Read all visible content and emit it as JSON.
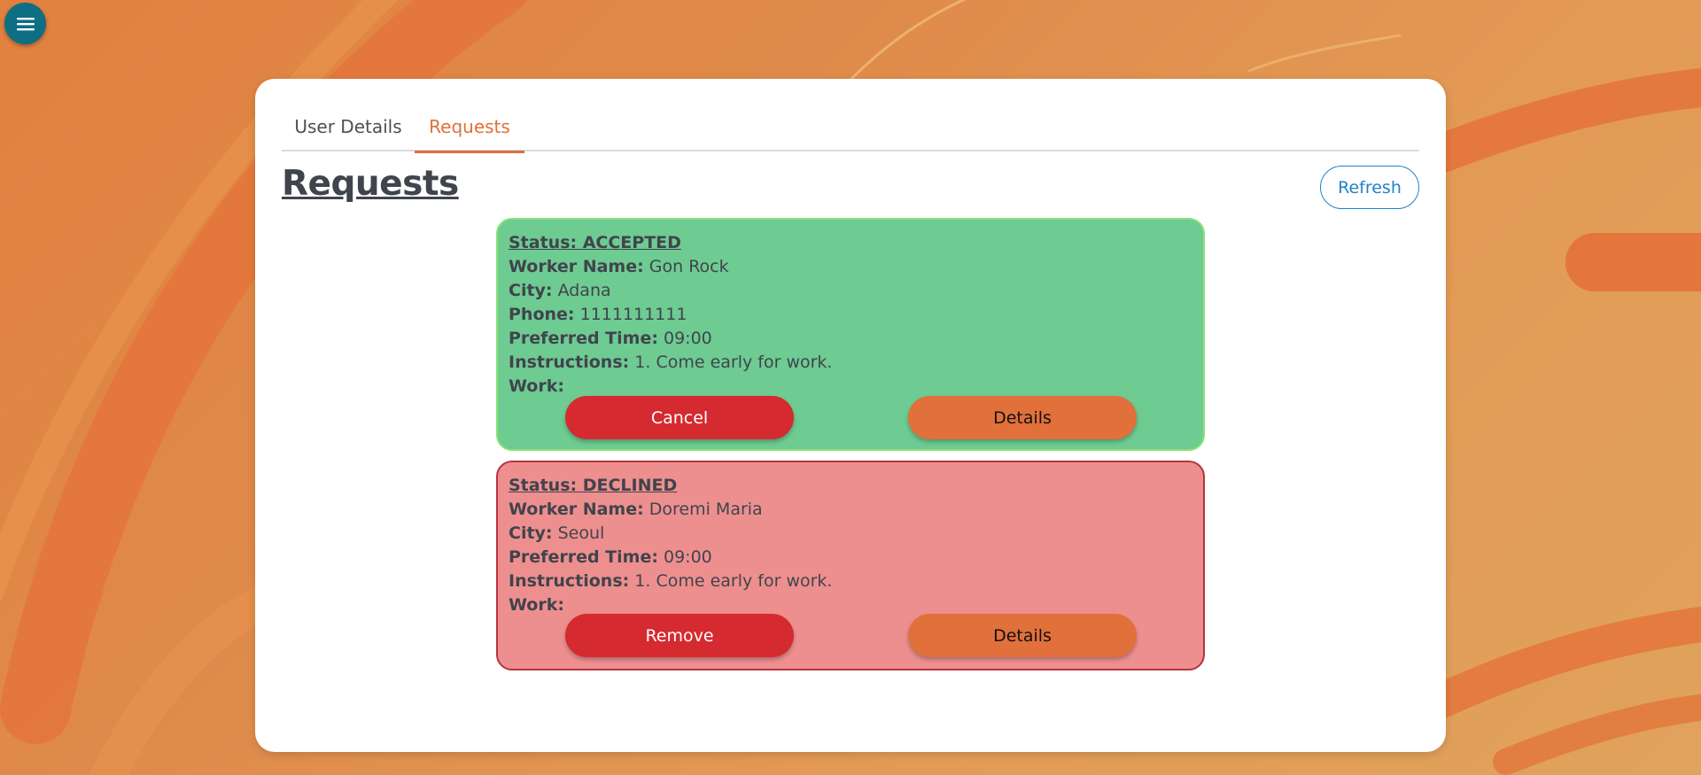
{
  "tabs": [
    {
      "label": "User Details"
    },
    {
      "label": "Requests"
    }
  ],
  "active_tab": "Requests",
  "page": {
    "title": "Requests",
    "refresh_label": "Refresh"
  },
  "requests": [
    {
      "status": "Status: ACCEPTED",
      "worker_name_label": "Worker Name:",
      "worker_name": "Gon Rock",
      "city_label": "City:",
      "city": "Adana",
      "phone_label": "Phone:",
      "phone": "1111111111",
      "preferred_time_label": "Preferred Time:",
      "preferred_time": "09:00",
      "instructions_label": "Instructions:",
      "instructions": "1. Come early for work.",
      "work_label": "Work:",
      "primary_action": "Cancel",
      "secondary_action": "Details"
    },
    {
      "status": "Status: DECLINED",
      "worker_name_label": "Worker Name:",
      "worker_name": "Doremi Maria",
      "city_label": "City:",
      "city": "Seoul",
      "preferred_time_label": "Preferred Time:",
      "preferred_time": "09:00",
      "instructions_label": "Instructions:",
      "instructions": "1. Come early for work.",
      "work_label": "Work:",
      "primary_action": "Remove",
      "secondary_action": "Details"
    }
  ],
  "icons": {
    "menu": "menu-icon"
  },
  "colors": {
    "accent": "#e07038",
    "menu_button": "#0e6e84",
    "refresh": "#1f83c8",
    "accepted_card": "#6ecb92",
    "declined_card": "#ee8f8f",
    "danger_button": "#d52a2f",
    "details_button": "#e2703b"
  }
}
